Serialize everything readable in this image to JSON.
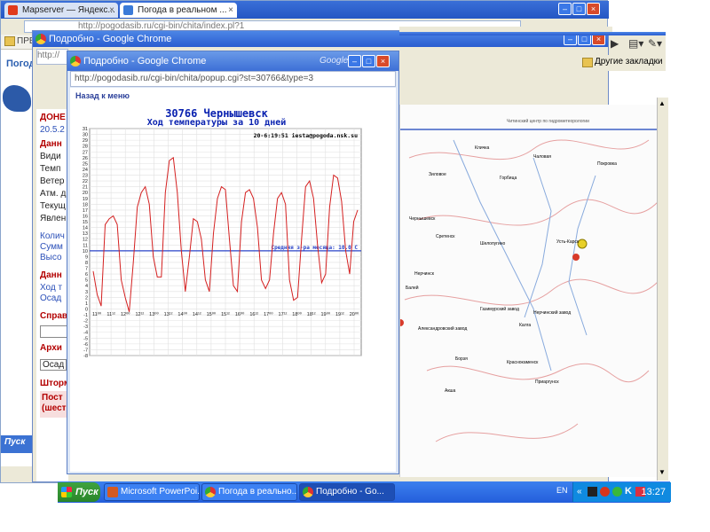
{
  "back_window": {
    "tabs": [
      {
        "label": "Mapserver — Яндекс...",
        "icon": "yandex-icon"
      },
      {
        "label": "Погода в реальном ...",
        "icon": "weather-page-icon"
      }
    ],
    "address": "http://pogodasib.ru/cgi-bin/chita/index.pl?1",
    "bookmark_label": "ПРВ",
    "left_text": "Погод"
  },
  "middle_window": {
    "title": "Подробно - Google Chrome",
    "address": "http://",
    "bookmarks_label": "Другие закладки",
    "left_items": [
      {
        "text": "ДОНЕ",
        "style": "red"
      },
      {
        "text": "20.5.2",
        "style": "blue"
      },
      {
        "text": "Данн",
        "style": "red"
      },
      {
        "text": "Види",
        "style": ""
      },
      {
        "text": "Темп",
        "style": ""
      },
      {
        "text": "Ветер",
        "style": ""
      },
      {
        "text": "Атм. д",
        "style": ""
      },
      {
        "text": "Текущ",
        "style": ""
      },
      {
        "text": "Явлен",
        "style": ""
      },
      {
        "text": "Колич",
        "style": "blue"
      },
      {
        "text": "Сумм",
        "style": "blue"
      },
      {
        "text": "Высо",
        "style": "blue"
      },
      {
        "text": "Данн",
        "style": "red"
      },
      {
        "text": "Ход т",
        "style": "blue"
      },
      {
        "text": "Осад",
        "style": "blue"
      },
      {
        "text": "Справ",
        "style": "red"
      },
      {
        "text": "Архи",
        "style": "red"
      },
      {
        "text": "Осад",
        "style": ""
      },
      {
        "text": "Шторм",
        "style": "red"
      },
      {
        "text": "Пост",
        "style": "red"
      },
      {
        "text": "(шест",
        "style": "red"
      }
    ],
    "map_header": "Читинский центр по гидрометеорологии",
    "map_places": [
      "Кличка",
      "Зиловое",
      "Чернышевск",
      "Сретенск",
      "Шелопугино",
      "Нерчинск",
      "Балей",
      "Газимурский завод",
      "Усть-Карск",
      "Покровка",
      "Александровский завод",
      "Борзя",
      "Краснокаменск",
      "Калга",
      "Акша",
      "Нерчинский завод",
      "Приаргунск",
      "Чаловая",
      "Горбица"
    ]
  },
  "popup_window": {
    "title": "Подробно - Google Chrome",
    "brand": "Google",
    "address": "http://pogodasib.ru/cgi-bin/chita/popup.cgi?st=30766&type=3",
    "back_link": "Назад к меню"
  },
  "chart_data": {
    "type": "line",
    "title": "30766 Чернышевск",
    "subtitle": "Ход температуры за 10 дней",
    "stamp": "20-6:19:51 iesta@pogoda.nsk.su",
    "ylim": [
      -8,
      31
    ],
    "y_ticks": [
      31,
      30,
      29,
      28,
      27,
      26,
      25,
      24,
      23,
      22,
      21,
      20,
      19,
      18,
      17,
      16,
      15,
      14,
      13,
      12,
      11,
      10,
      9,
      8,
      7,
      6,
      5,
      4,
      3,
      2,
      1,
      0,
      -1,
      -2,
      -3,
      -4,
      -5,
      -6,
      -7,
      -8
    ],
    "x_ticks": [
      "11⁰⁰",
      "11¹²",
      "12⁰⁰",
      "12¹²",
      "13⁰⁰",
      "13¹²",
      "14⁰⁰",
      "14¹²",
      "15⁰⁰",
      "15¹²",
      "16⁰⁰",
      "16¹²",
      "17⁰⁰",
      "17¹²",
      "18⁰⁰",
      "18¹²",
      "19⁰⁰",
      "19¹²",
      "20⁰⁰"
    ],
    "series": [
      {
        "values": [
          6.5,
          2.5,
          0.5,
          14.5,
          15.5,
          16,
          14.5,
          5,
          2,
          -0.5,
          8,
          17.5,
          20,
          21,
          18,
          9,
          5.5,
          5.5,
          20,
          25.5,
          26,
          20,
          10,
          3,
          9,
          15.5,
          15,
          12,
          5,
          3,
          13,
          19,
          21,
          20.5,
          12,
          4,
          3,
          15,
          20,
          20.5,
          19,
          14,
          5,
          3.5,
          5,
          13,
          19,
          20,
          18,
          5,
          1.5,
          2,
          12,
          21,
          22,
          19,
          11,
          4.5,
          6,
          17.5,
          23,
          22.5,
          18.5,
          10,
          6,
          15,
          17
        ]
      }
    ],
    "reference_line": {
      "value": 10.0,
      "label": "Средняя з-ра месяца: 10.0 С"
    }
  },
  "taskbar": {
    "start_label": "Пуск",
    "tasks": [
      {
        "label": "Microsoft PowerPoi...",
        "icon": "powerpoint-icon"
      },
      {
        "label": "Погода в реально...",
        "icon": "chrome-icon"
      },
      {
        "label": "Подробно - Go...",
        "icon": "chrome-icon"
      }
    ],
    "lang": "EN",
    "clock": "13:27"
  },
  "colors": {
    "line": "#d42020",
    "reference_line": "#2a44c8",
    "title_blue": "#0a22b0",
    "taskbar": "#245edb"
  }
}
